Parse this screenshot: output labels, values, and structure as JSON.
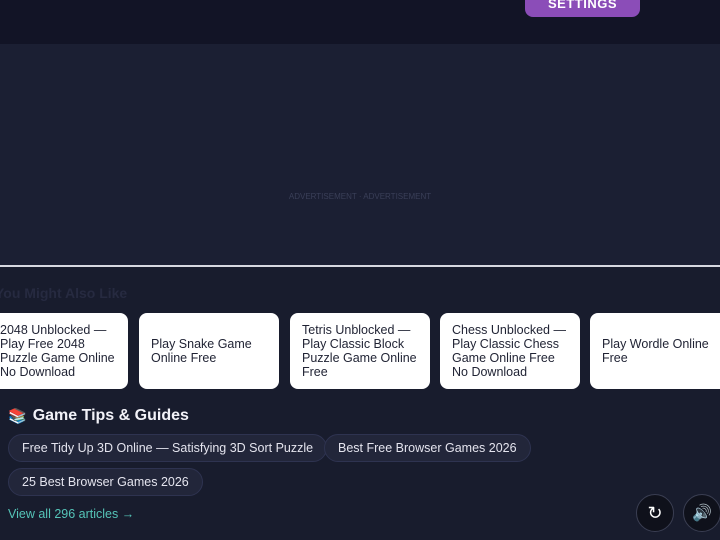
{
  "header": {
    "settings_label": "SETTINGS"
  },
  "ad": {
    "label": "ADVERTISEMENT · ADVERTISEMENT"
  },
  "recommendations": {
    "title": "You Might Also Like",
    "items": [
      {
        "label": "2048 Unblocked — Play Free 2048 Puzzle Game Online No Download"
      },
      {
        "label": "Play Snake Game Online Free"
      },
      {
        "label": "Tetris Unblocked — Play Classic Block Puzzle Game Online Free"
      },
      {
        "label": "Chess Unblocked — Play Classic Chess Game Online Free No Download"
      },
      {
        "label": "Play Wordle Online Free"
      }
    ]
  },
  "guides": {
    "icon": "books-icon",
    "icon_glyph": "📚",
    "title": "Game Tips & Guides",
    "articles": [
      {
        "label": "Free Tidy Up 3D Online — Satisfying 3D Sort Puzzle"
      },
      {
        "label": "Best Free Browser Games 2026"
      },
      {
        "label": "25 Best Browser Games 2026"
      }
    ],
    "view_all": "View all 296 articles →"
  },
  "controls": {
    "refresh_icon": "↻",
    "sound_icon": "🔊"
  },
  "colors": {
    "accent": "#8b4db8",
    "link": "#55c4b8",
    "background": "#181c2d"
  }
}
